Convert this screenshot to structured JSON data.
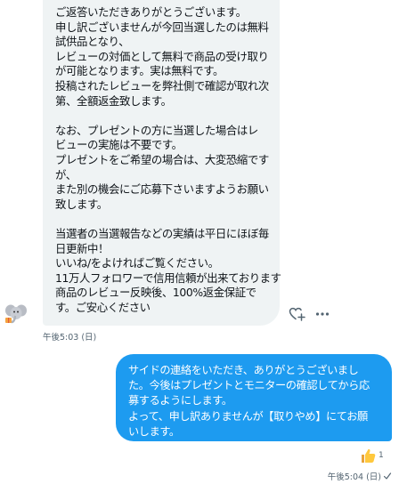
{
  "incoming": {
    "lines": [
      "ご返答いただきありがとうございます。",
      "申し訳ございませんが今回当選したのは無料",
      "試供品となり、",
      "レビューの対価として無料で商品の受け取り",
      "が可能となります。実は無料です。",
      "投稿されたレビューを弊社側で確認が取れ次",
      "第、全額返金致します。",
      "",
      "なお、プレゼントの方に当選した場合はレ",
      "ビューの実施は不要です。",
      "プレゼントをご希望の場合は、大変恐縮です",
      "が、",
      "また別の機会にご応募下さいますようお願い",
      "致します。",
      "",
      "当選者の当選報告などの実績は平日にほぼ毎",
      "日更新中！",
      "いいね/をよければご覧ください。",
      "11万人フォロワーで信用信頼が出来ております",
      "商品のレビュー反映後、100%返金保証で",
      "す。ご安心ください"
    ],
    "time": "午後5:03 (日)"
  },
  "outgoing": {
    "lines": [
      "サイドの連絡をいただき、ありがとうございまし",
      "た。今後はプレゼントとモニターの確認してから応",
      "募するようにします。",
      "よって、申し訳ありませんが【取りやめ】にてお願",
      "いします。"
    ],
    "time": "午後5:04 (日)",
    "reaction": {
      "emoji_icon": "thumbs-up-icon",
      "count": "1"
    }
  },
  "colors": {
    "accent": "#1d9bf0",
    "incoming_bg": "#eff3f4",
    "muted": "#536471"
  }
}
